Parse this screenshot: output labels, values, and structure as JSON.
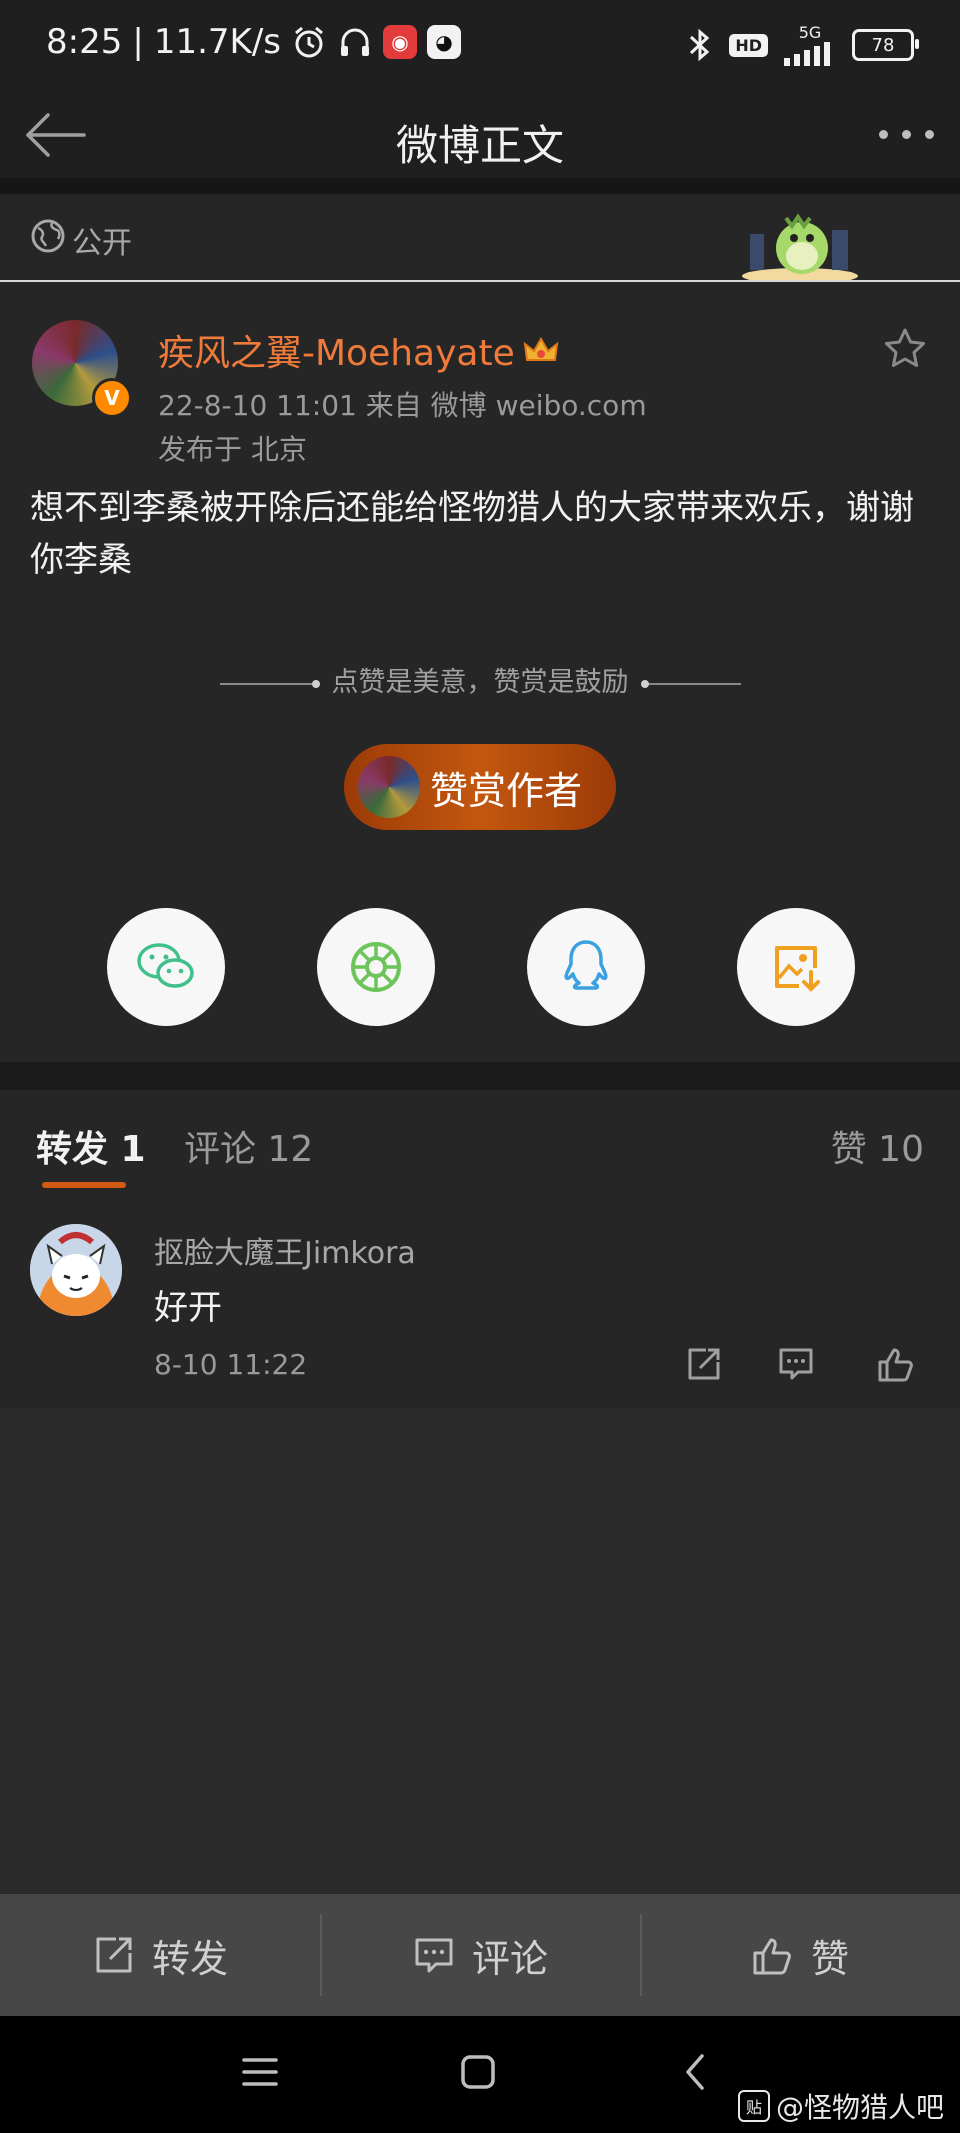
{
  "status_bar": {
    "time": "8:25",
    "net_speed": "11.7K/s",
    "network": "5G",
    "hd": "HD",
    "battery": "78"
  },
  "header": {
    "title": "微博正文"
  },
  "post": {
    "visibility": "公开",
    "author": "疾风之翼-Moehayate",
    "verified_badge": "V",
    "meta": "22-8-10 11:01  来自 微博 weibo.com",
    "location": "发布于 北京",
    "content": "想不到李桑被开除后还能给怪物猎人的大家带来欢乐，谢谢你李桑",
    "reward_prompt": "点赞是美意，赞赏是鼓励",
    "reward_button": "赞赏作者",
    "share_icons": [
      "wechat-icon",
      "moments-icon",
      "qq-icon",
      "save-image-icon"
    ]
  },
  "tabs": {
    "repost": "转发 1",
    "comments": "评论 12",
    "likes": "赞 10"
  },
  "comments": [
    {
      "user": "抠脸大魔王Jimkora",
      "text": "好开",
      "time": "8-10 11:22"
    }
  ],
  "action_bar": {
    "repost": "转发",
    "comment": "评论",
    "like": "赞"
  },
  "watermark": {
    "badge": "贴",
    "text": "@怪物猎人吧"
  },
  "colors": {
    "accent": "#d35a14",
    "author": "#f07a3a",
    "background": "#262626"
  }
}
